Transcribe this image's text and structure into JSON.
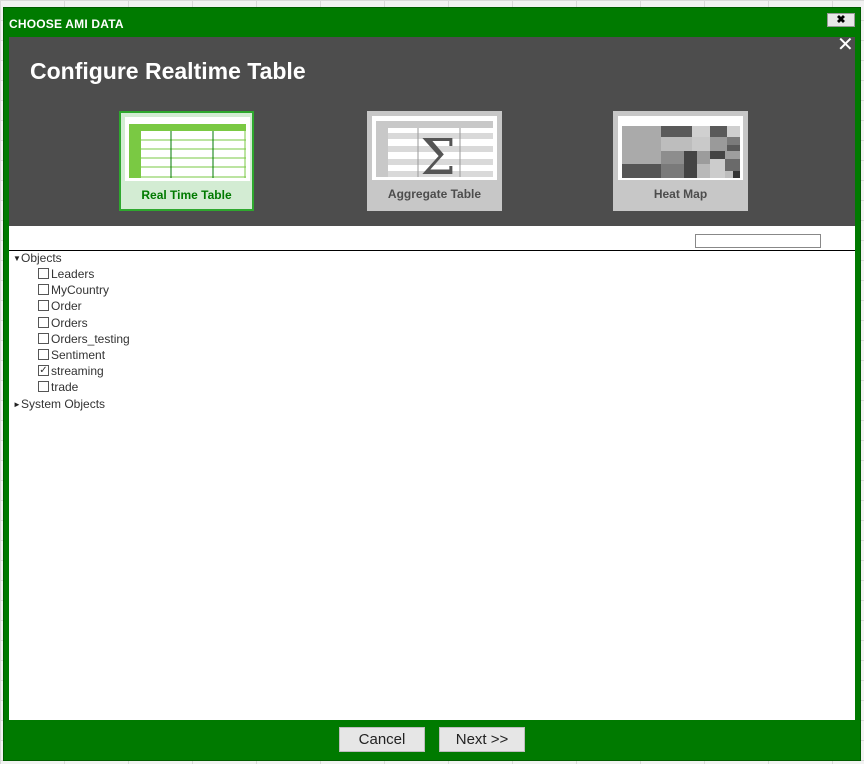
{
  "dialog": {
    "title": "CHOOSE AMI DATA",
    "close_glyph": "✖"
  },
  "header": {
    "title": "Configure Realtime Table",
    "close_glyph": "✕"
  },
  "options": [
    {
      "label": "Real Time Table",
      "selected": true
    },
    {
      "label": "Aggregate Table",
      "selected": false
    },
    {
      "label": "Heat Map",
      "selected": false
    }
  ],
  "search": {
    "value": "",
    "placeholder": ""
  },
  "tree": {
    "objects_label": "Objects",
    "objects_expanded": true,
    "items": [
      {
        "label": "Leaders",
        "checked": false
      },
      {
        "label": "MyCountry",
        "checked": false
      },
      {
        "label": "Order",
        "checked": false
      },
      {
        "label": "Orders",
        "checked": false
      },
      {
        "label": "Orders_testing",
        "checked": false
      },
      {
        "label": "Sentiment",
        "checked": false
      },
      {
        "label": "streaming",
        "checked": true
      },
      {
        "label": "trade",
        "checked": false
      }
    ],
    "system_label": "System Objects",
    "system_expanded": false,
    "check_glyph": "✓",
    "expanded_arrow": "▼",
    "collapsed_arrow": "►"
  },
  "footer": {
    "cancel_label": "Cancel",
    "next_label": "Next >>"
  },
  "colors": {
    "frame_green": "#007a00",
    "header_gray": "#4d4d4d",
    "table_icon_green": "#7ac943",
    "selected_border": "#2ea82e"
  }
}
